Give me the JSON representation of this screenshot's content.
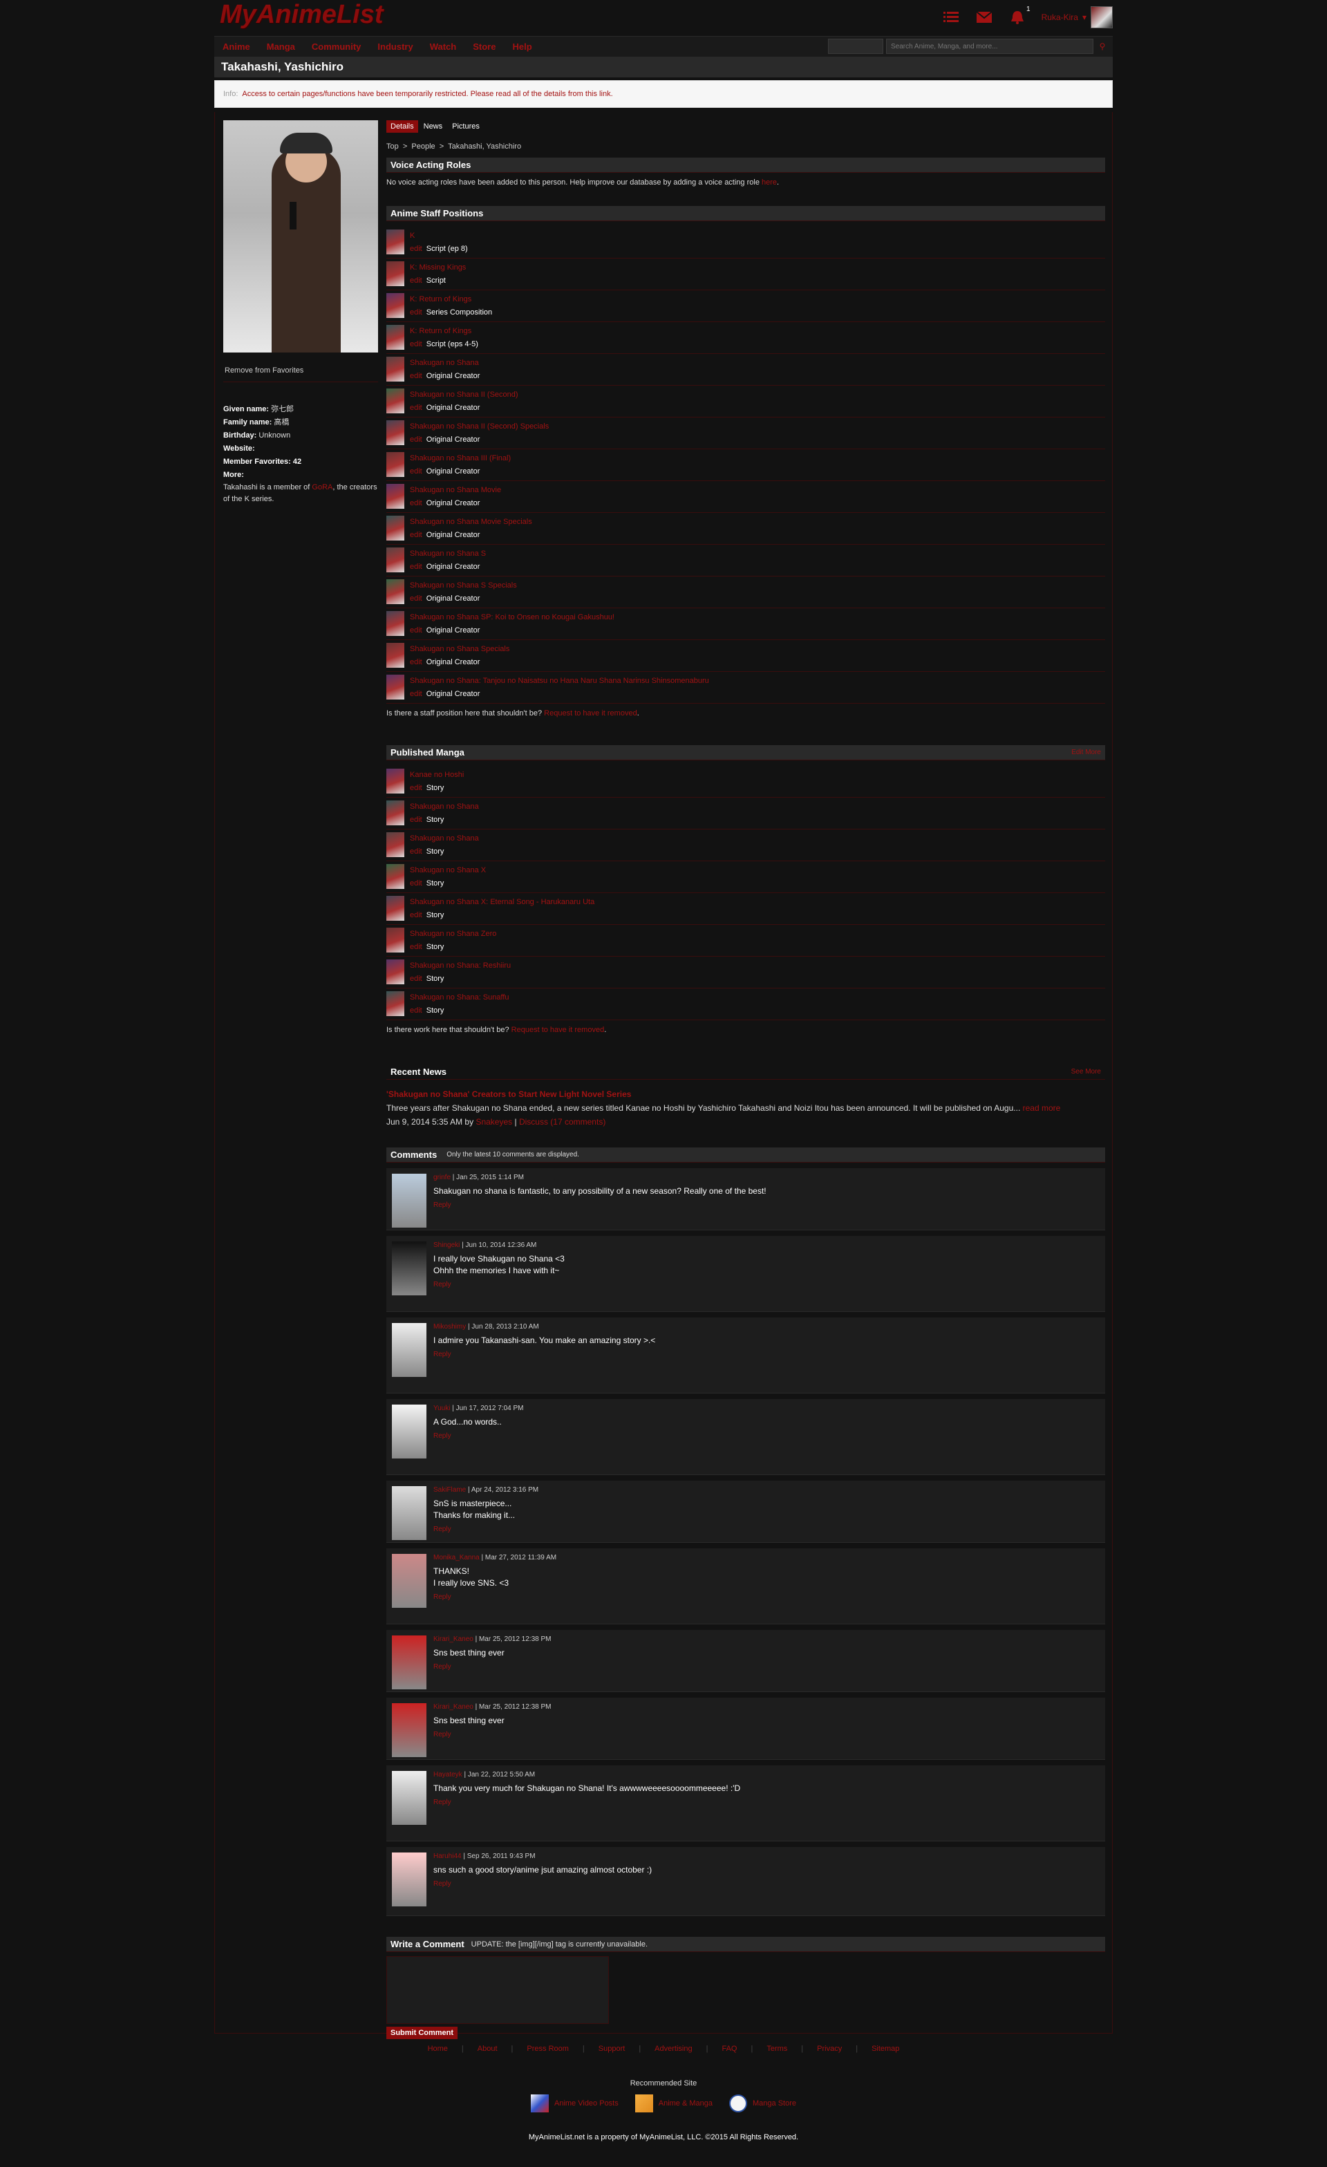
{
  "header": {
    "logo": "MyAnimeList",
    "username": "Ruka-Kira",
    "notification_count": "1"
  },
  "nav": {
    "items": [
      "Anime",
      "Manga",
      "Community",
      "Industry",
      "Watch",
      "Store",
      "Help"
    ],
    "search_placeholder": "Search Anime, Manga, and more..."
  },
  "page": {
    "title": "Takahashi, Yashichiro",
    "info_label": "Info:",
    "info_text": "Access to certain pages/functions have been temporarily restricted. Please read all of the details from this link."
  },
  "left": {
    "remove_favorites": "Remove from Favorites",
    "given_name_label": "Given name:",
    "given_name": "弥七郎",
    "family_name_label": "Family name:",
    "family_name": "高橋",
    "birthday_label": "Birthday:",
    "birthday": "Unknown",
    "website_label": "Website:",
    "member_fav_label": "Member Favorites:",
    "member_fav": "42",
    "more_label": "More:",
    "more_pre": "Takahashi is a member of",
    "more_link": "GoRA",
    "more_post": ", the creators of the K series."
  },
  "tabs": [
    "Details",
    "News",
    "Pictures"
  ],
  "breadcrumb": "Top  >  People  >  Takahashi, Yashichiro",
  "voice": {
    "heading": "Voice Acting Roles",
    "text": "No voice acting roles have been added to this person. Help improve our database by adding a voice acting role",
    "link": "here",
    "end": "."
  },
  "staff": {
    "heading": "Anime Staff Positions",
    "edit": "edit",
    "rows": [
      {
        "title": "K",
        "role": "Script (ep 8)"
      },
      {
        "title": "K: Missing Kings",
        "role": "Script"
      },
      {
        "title": "K: Return of Kings",
        "role": "Series Composition"
      },
      {
        "title": "K: Return of Kings",
        "role": "Script (eps 4-5)"
      },
      {
        "title": "Shakugan no Shana",
        "role": "Original Creator"
      },
      {
        "title": "Shakugan no Shana II (Second)",
        "role": "Original Creator"
      },
      {
        "title": "Shakugan no Shana II (Second) Specials",
        "role": "Original Creator"
      },
      {
        "title": "Shakugan no Shana III (Final)",
        "role": "Original Creator"
      },
      {
        "title": "Shakugan no Shana Movie",
        "role": "Original Creator"
      },
      {
        "title": "Shakugan no Shana Movie Specials",
        "role": "Original Creator"
      },
      {
        "title": "Shakugan no Shana S",
        "role": "Original Creator"
      },
      {
        "title": "Shakugan no Shana S Specials",
        "role": "Original Creator"
      },
      {
        "title": "Shakugan no Shana SP: Koi to Onsen no Kougai Gakushuu!",
        "role": "Original Creator"
      },
      {
        "title": "Shakugan no Shana Specials",
        "role": "Original Creator"
      },
      {
        "title": "Shakugan no Shana: Tanjou no Naisatsu no Hana Naru Shana Narinsu Shinsomenaburu",
        "role": "Original Creator"
      }
    ],
    "footer_q": "Is there a staff position here that shouldn't be?",
    "footer_link": "Request to have it removed",
    "footer_end": "."
  },
  "manga": {
    "heading": "Published Manga",
    "side": "Edit More",
    "rows": [
      {
        "title": "Kanae no Hoshi",
        "role": "Story"
      },
      {
        "title": "Shakugan no Shana",
        "role": "Story"
      },
      {
        "title": "Shakugan no Shana",
        "role": "Story"
      },
      {
        "title": "Shakugan no Shana X",
        "role": "Story"
      },
      {
        "title": "Shakugan no Shana X: Eternal Song - Harukanaru Uta",
        "role": "Story"
      },
      {
        "title": "Shakugan no Shana Zero",
        "role": "Story"
      },
      {
        "title": "Shakugan no Shana: Reshiiru",
        "role": "Story"
      },
      {
        "title": "Shakugan no Shana: Sunaffu",
        "role": "Story"
      }
    ],
    "footer_q": "Is there work here that shouldn't be?",
    "footer_link": "Request to have it removed",
    "footer_end": "."
  },
  "news": {
    "heading": "Recent News",
    "side": "See More",
    "title": "'Shakugan no Shana' Creators to Start New Light Novel Series",
    "body": "Three years after Shakugan no Shana ended, a new series titled Kanae no Hoshi by Yashichiro Takahashi and Noizi Itou has been announced. It will be published on Augu...",
    "read_more": "read more",
    "date": "Jun 9, 2014 5:35 AM by",
    "author": "Snakeyes",
    "sep": "|",
    "discuss": "Discuss (17 comments)"
  },
  "comments": {
    "heading": "Comments",
    "note": "Only the latest 10 comments are displayed.",
    "reply": "Reply",
    "items": [
      {
        "user": "grinfe",
        "date": "Jan 25, 2015 1:14 PM",
        "text": "Shakugan no shana is fantastic, to any possibility of a new season? Really one of the best!"
      },
      {
        "user": "Shingeki",
        "date": "Jun 10, 2014 12:36 AM",
        "text": "I really love Shakugan no Shana <3\nOhhh the memories I have with it~"
      },
      {
        "user": "Mikoshimy",
        "date": "Jun 28, 2013 2:10 AM",
        "text": "I admire you Takanashi-san. You make an amazing story >.<"
      },
      {
        "user": "Yuuki",
        "date": "Jun 17, 2012 7:04 PM",
        "text": "A God...no words.."
      },
      {
        "user": "SakiFlame",
        "date": "Apr 24, 2012 3:16 PM",
        "text": "SnS is masterpiece...\nThanks for making it..."
      },
      {
        "user": "Monika_Kanna",
        "date": "Mar 27, 2012 11:39 AM",
        "text": "THANKS!\nI really love SNS. <3"
      },
      {
        "user": "Kirari_Kaneo",
        "date": "Mar 25, 2012 12:38 PM",
        "text": "Sns best thing ever"
      },
      {
        "user": "Kirari_Kaneo",
        "date": "Mar 25, 2012 12:38 PM",
        "text": "Sns best thing ever"
      },
      {
        "user": "Hayateyk",
        "date": "Jan 22, 2012 5:50 AM",
        "text": "Thank you very much for Shakugan no Shana! It's awwwweeeesoooommeeeee! :'D"
      },
      {
        "user": "Haruhi44",
        "date": "Sep 26, 2011 9:43 PM",
        "text": "sns such a good story/anime jsut amazing almost october :)"
      }
    ]
  },
  "write": {
    "heading": "Write a Comment",
    "note": "UPDATE: the [img][/img] tag is currently unavailable.",
    "submit": "Submit Comment"
  },
  "footer": {
    "links": [
      "Home",
      "About",
      "Press Room",
      "Support",
      "Advertising",
      "FAQ",
      "Terms",
      "Privacy",
      "Sitemap"
    ],
    "recommended": "Recommended Site",
    "rec_sites": [
      "Anime Video Posts",
      "Anime & Manga",
      "Manga Store"
    ],
    "copyright": "MyAnimeList.net is a property of MyAnimeList, LLC. ©2015 All Rights Reserved."
  },
  "colors": {
    "accent": "#a31212",
    "background": "#121212",
    "panel": "#2a2a2a"
  }
}
